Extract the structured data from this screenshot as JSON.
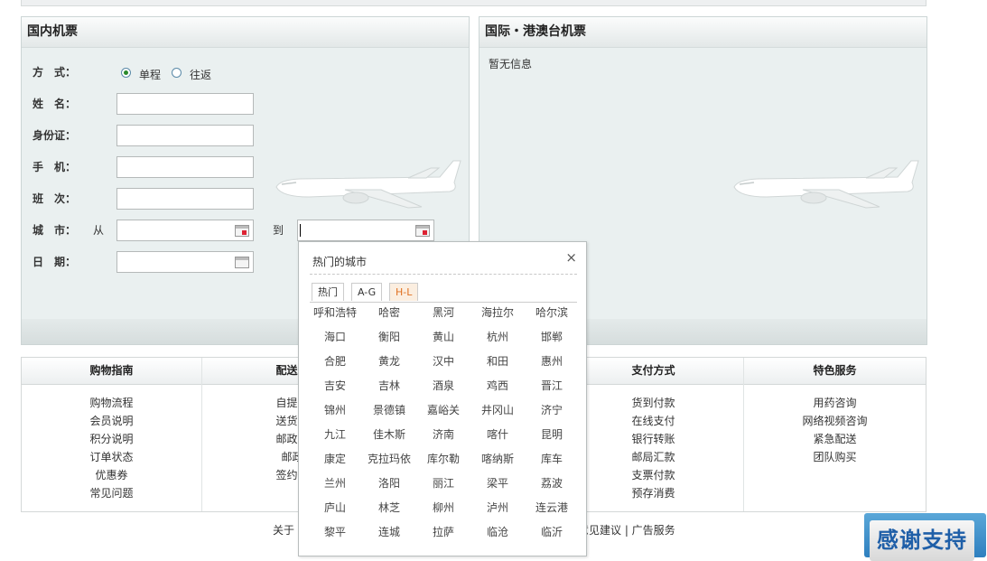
{
  "domestic": {
    "title": "国内机票",
    "labels": {
      "mode": "方　式：",
      "name": "姓　名：",
      "id_card": "身份证：",
      "phone": "手　机：",
      "flight": "班　次：",
      "city": "城　市：",
      "date": "日　期："
    },
    "mode_options": [
      "单程",
      "往返"
    ],
    "mode_selected": "单程",
    "from_label": "从",
    "to_label": "到"
  },
  "international": {
    "title": "国际・港澳台机票",
    "empty_text": "暂无信息"
  },
  "city_popup": {
    "title": "热门的城市",
    "close_glyph": "×",
    "tabs": [
      "热门",
      "A-G",
      "H-L"
    ],
    "selected_tab": "H-L",
    "cities": [
      "呼和浩特",
      "哈密",
      "黑河",
      "海拉尔",
      "哈尔滨",
      "海口",
      "衡阳",
      "黄山",
      "杭州",
      "邯郸",
      "合肥",
      "黄龙",
      "汉中",
      "和田",
      "惠州",
      "吉安",
      "吉林",
      "酒泉",
      "鸡西",
      "晋江",
      "锦州",
      "景德镇",
      "嘉峪关",
      "井冈山",
      "济宁",
      "九江",
      "佳木斯",
      "济南",
      "喀什",
      "昆明",
      "康定",
      "克拉玛依",
      "库尔勒",
      "喀纳斯",
      "库车",
      "兰州",
      "洛阳",
      "丽江",
      "梁平",
      "荔波",
      "庐山",
      "林芝",
      "柳州",
      "泸州",
      "连云港",
      "黎平",
      "连城",
      "拉萨",
      "临沧",
      "临沂"
    ]
  },
  "guide": {
    "columns": [
      {
        "header": "购物指南",
        "items": [
          "购物流程",
          "会员说明",
          "积分说明",
          "订单状态",
          "优惠券",
          "常见问题"
        ]
      },
      {
        "header": "配送方",
        "items": [
          "自提说",
          "送货上",
          "邮政包",
          "邮政",
          "签约快"
        ]
      },
      {
        "header": "",
        "items": []
      },
      {
        "header": "支付方式",
        "items": [
          "货到付款",
          "在线支付",
          "银行转账",
          "邮局汇款",
          "支票付款",
          "预存消费"
        ]
      },
      {
        "header": "特色服务",
        "items": [
          "用药咨询",
          "网络视频咨询",
          "紧急配送",
          "团队购买"
        ]
      }
    ]
  },
  "footer": {
    "left": "关于",
    "right": "意见建议 | 广告服务"
  },
  "thanks_badge": "感谢支持"
}
